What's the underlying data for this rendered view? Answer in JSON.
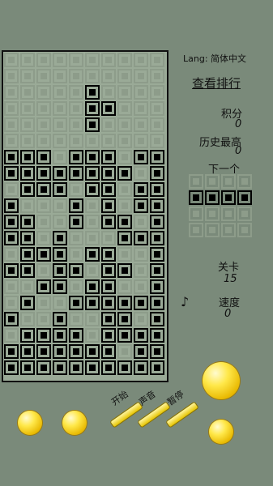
{
  "sidebar": {
    "lang": "Lang: 简体中文",
    "rank_link": "查看排行",
    "score_label": "积分",
    "score_value": "0",
    "best_label": "历史最高",
    "best_value": "0",
    "next_label": "下一个",
    "level_label": "关卡",
    "level_value": "15",
    "speed_label": "速度",
    "speed_value": "0",
    "music_icon": "♪"
  },
  "controls": {
    "start_label": "开始",
    "sound_label": "声音",
    "pause_label": "暂停"
  },
  "board": {
    "cols": 10,
    "rows": 20,
    "cells": [
      "0000000000",
      "0000000000",
      "0000010000",
      "0000011000",
      "0000010000",
      "0000000000",
      "1110111011",
      "1111111101",
      "0111011011",
      "1000101011",
      "1100101101",
      "1101000111",
      "0111011001",
      "1101101101",
      "0011011001",
      "0100111111",
      "1001001101",
      "0111101111",
      "1111111011",
      "1111111111"
    ]
  },
  "next_piece": {
    "cells": [
      "0000",
      "1111",
      "0000",
      "0000"
    ]
  }
}
